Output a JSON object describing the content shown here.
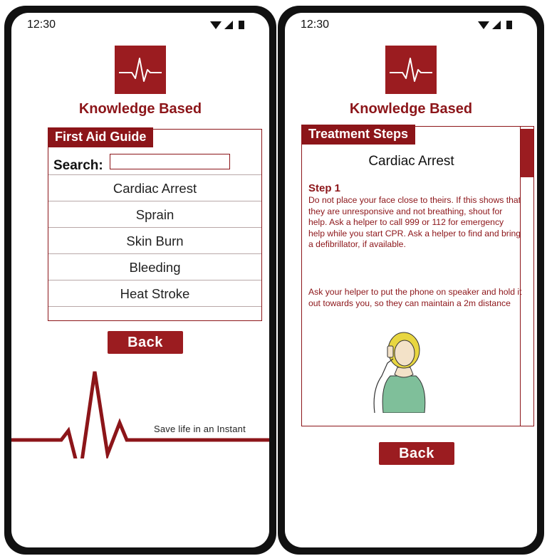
{
  "status": {
    "time": "12:30"
  },
  "brand": {
    "title": "Knowledge Based"
  },
  "guide": {
    "tab_label": "First Aid Guide",
    "search_label": "Search:",
    "search_value": "",
    "items": [
      {
        "label": "Cardiac Arrest"
      },
      {
        "label": "Sprain"
      },
      {
        "label": "Skin Burn"
      },
      {
        "label": "Bleeding"
      },
      {
        "label": "Heat Stroke"
      }
    ],
    "back_label": "Back",
    "tagline": "Save life in an Instant"
  },
  "treatment": {
    "tab_label": "Treatment Steps",
    "condition": "Cardiac Arrest",
    "step_title": "Step 1",
    "paragraph1": "Do not place your face close to theirs. If this shows that they are unresponsive and not breathing, shout for help. Ask a helper to call 999 or 112 for emergency help while you start CPR. Ask a helper to find and bring a defibrillator, if available.",
    "paragraph2": "Ask your helper to put the phone on speaker and hold it out towards you, so they can maintain a 2m distance",
    "back_label": "Back"
  },
  "icons": [
    "heartbeat-logo-icon",
    "wifi-icon",
    "signal-icon",
    "battery-icon",
    "ecg-line-icon",
    "person-on-phone-illustration"
  ],
  "colors": {
    "brand": "#8c1519",
    "button": "#9b1c20",
    "frame": "#111111",
    "text": "#111111"
  }
}
